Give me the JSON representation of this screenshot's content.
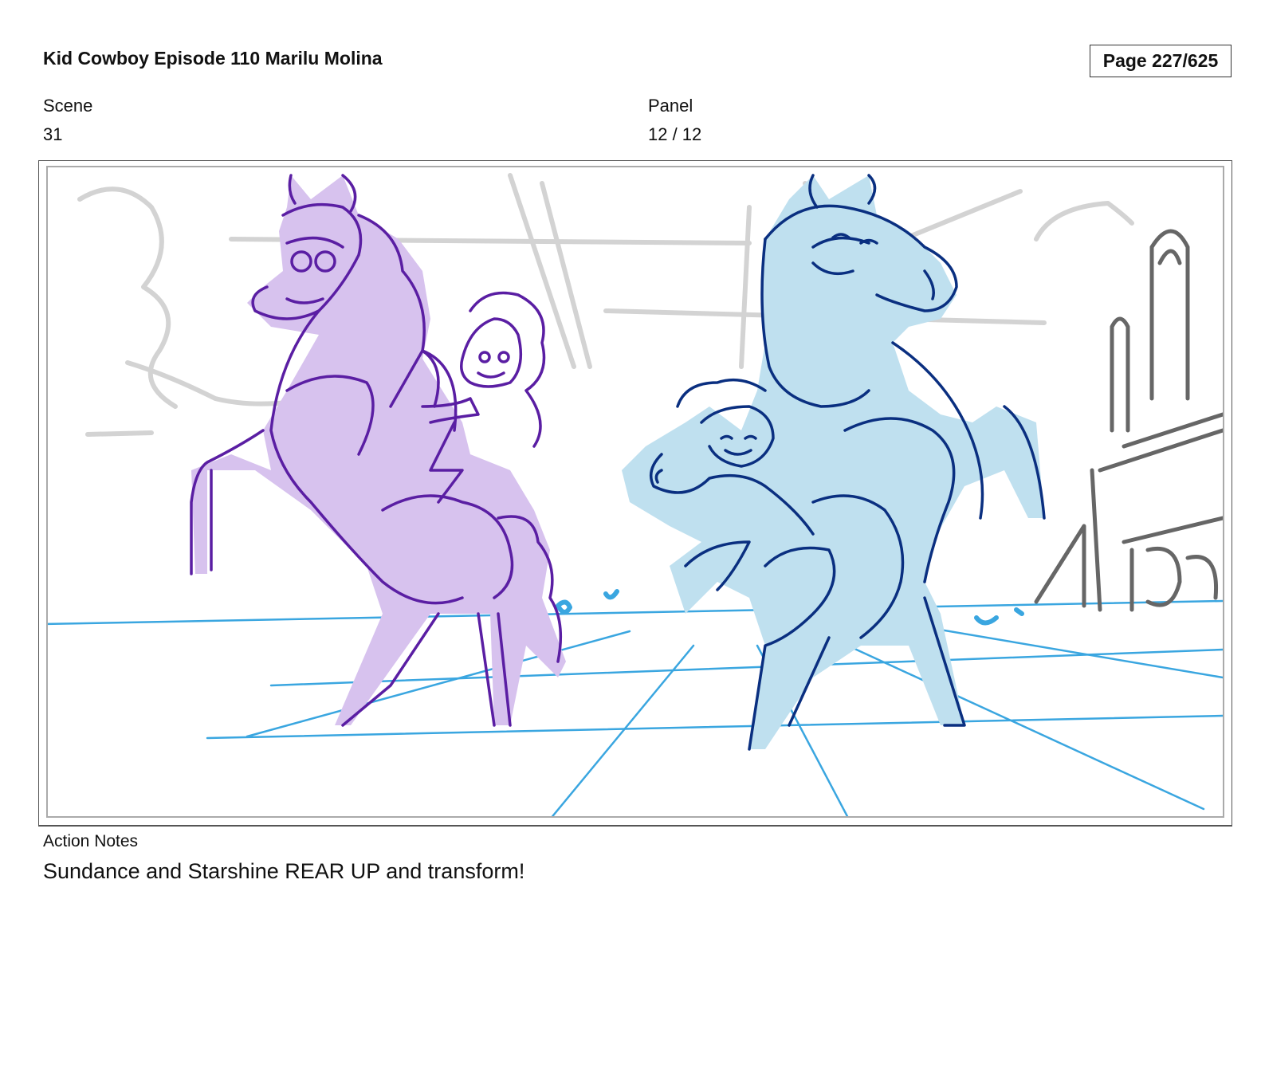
{
  "header": {
    "title": "Kid Cowboy Episode 110 Marilu Molina",
    "page": "Page 227/625"
  },
  "scene": {
    "label": "Scene",
    "value": "31"
  },
  "panel": {
    "label": "Panel",
    "value": "12 / 12"
  },
  "action_notes": {
    "label": "Action Notes",
    "text": "Sundance and Starshine REAR UP and transform!"
  },
  "colors": {
    "purple_fill": "#d7c2ee",
    "purple_line": "#5a1ea3",
    "blue_fill": "#bfe0ef",
    "blue_line": "#0a2f80",
    "grid_line": "#3aa6e0",
    "bg_sketch": "#d0d0d0",
    "prop_sketch": "#666666"
  }
}
